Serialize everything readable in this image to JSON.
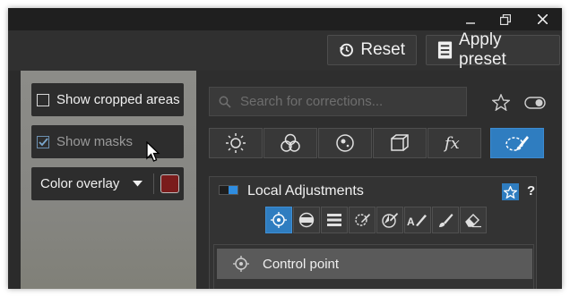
{
  "toolbar": {
    "reset_label": "Reset",
    "apply_preset_label": "Apply preset"
  },
  "overlays": {
    "show_cropped_label": "Show cropped areas",
    "show_masks_label": "Show masks",
    "color_overlay_label": "Color overlay",
    "overlay_color": "#7a1c1c"
  },
  "search": {
    "placeholder": "Search for corrections..."
  },
  "categories": [
    "light-icon",
    "color-icon",
    "detail-icon",
    "geometry-icon",
    "fx-icon",
    "local-adjustments-icon"
  ],
  "section": {
    "title": "Local Adjustments",
    "help": "?"
  },
  "tools": [
    "control-point-icon",
    "graduated-filter-icon",
    "eraser-lines-icon",
    "auto-mask-icon",
    "color-picker-icon",
    "text-brush-icon",
    "brush-icon",
    "eraser-icon"
  ],
  "control_point": {
    "label": "Control point"
  },
  "colors": {
    "accent": "#2f7dc0",
    "panel": "#2e2e2e",
    "overlay_swatch": "#7a1c1c"
  }
}
